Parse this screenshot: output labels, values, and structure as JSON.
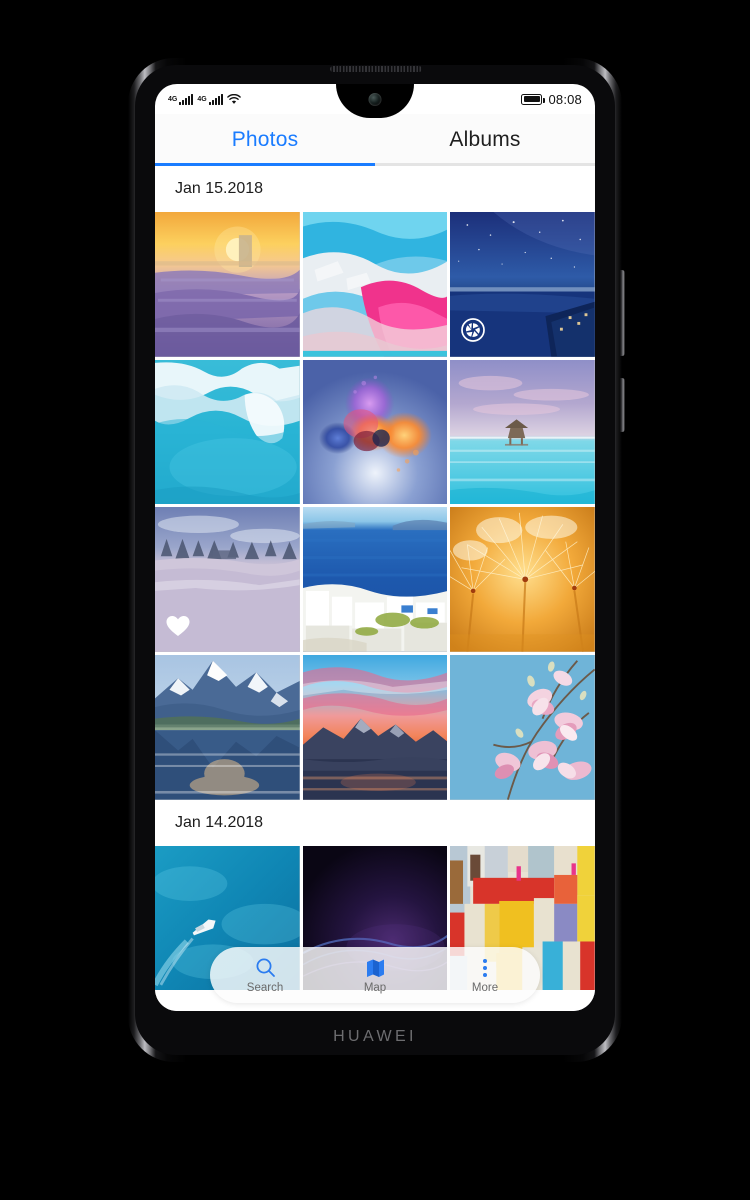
{
  "device": {
    "brand_logo": "HUAWEI"
  },
  "status_bar": {
    "signal_1": {
      "network": "4G",
      "bars": 5,
      "icon": "signal-bars-icon"
    },
    "signal_2": {
      "network": "4G",
      "bars": 5,
      "icon": "signal-bars-icon"
    },
    "wifi": {
      "icon": "wifi-icon"
    },
    "battery": {
      "icon": "battery-icon",
      "level_pct": 85
    },
    "time": "08:08"
  },
  "tabs": [
    {
      "label": "Photos",
      "active": true,
      "name": "tab-photos"
    },
    {
      "label": "Albums",
      "active": false,
      "name": "tab-albums"
    }
  ],
  "colors": {
    "accent": "#1a7cff",
    "tab_inactive": "#1f1f1f",
    "underline_track": "#e4e4e4",
    "toolbar_label": "#6a6a6a"
  },
  "gallery": {
    "sections": [
      {
        "date": "Jan 15.2018",
        "photos": [
          {
            "id": "p1",
            "description": "Lavender field at sunset with stone tower",
            "badge": null
          },
          {
            "id": "p2",
            "description": "Abstract pink and blue paint texture",
            "badge": null
          },
          {
            "id": "p3",
            "description": "Starry night sky over dark blue sea and cliffs",
            "badge": "camera-shutter-icon"
          },
          {
            "id": "p4",
            "description": "Iceberg in turquoise water",
            "badge": null
          },
          {
            "id": "p5",
            "description": "Colored powder explosion on blue background",
            "badge": null
          },
          {
            "id": "p6",
            "description": "Overwater bungalow on tropical lagoon",
            "badge": null
          },
          {
            "id": "p7",
            "description": "Snowy field with pine trees at dusk",
            "badge": "heart-icon"
          },
          {
            "id": "p8",
            "description": "Santorini white buildings above deep blue sea",
            "badge": null
          },
          {
            "id": "p9",
            "description": "Golden dandelion seed heads close up",
            "badge": null
          },
          {
            "id": "p10",
            "description": "Snow mountain reflected in calm lake",
            "badge": null
          },
          {
            "id": "p11",
            "description": "Pink and orange sunset over mountain lake",
            "badge": null
          },
          {
            "id": "p12",
            "description": "Pink magnolia blossoms against blue sky",
            "badge": null
          }
        ]
      },
      {
        "date": "Jan 14.2018",
        "photos": [
          {
            "id": "p13",
            "description": "Boat wake on turquoise sea from above",
            "badge": null
          },
          {
            "id": "p14",
            "description": "Dark purple abstract wave gradient",
            "badge": null
          },
          {
            "id": "p15",
            "description": "Colorful geometric abstract painting",
            "badge": null
          }
        ]
      }
    ]
  },
  "toolbar": [
    {
      "label": "Search",
      "icon": "search-icon",
      "name": "toolbar-search"
    },
    {
      "label": "Map",
      "icon": "map-icon",
      "name": "toolbar-map"
    },
    {
      "label": "More",
      "icon": "more-dots-icon",
      "name": "toolbar-more"
    }
  ]
}
